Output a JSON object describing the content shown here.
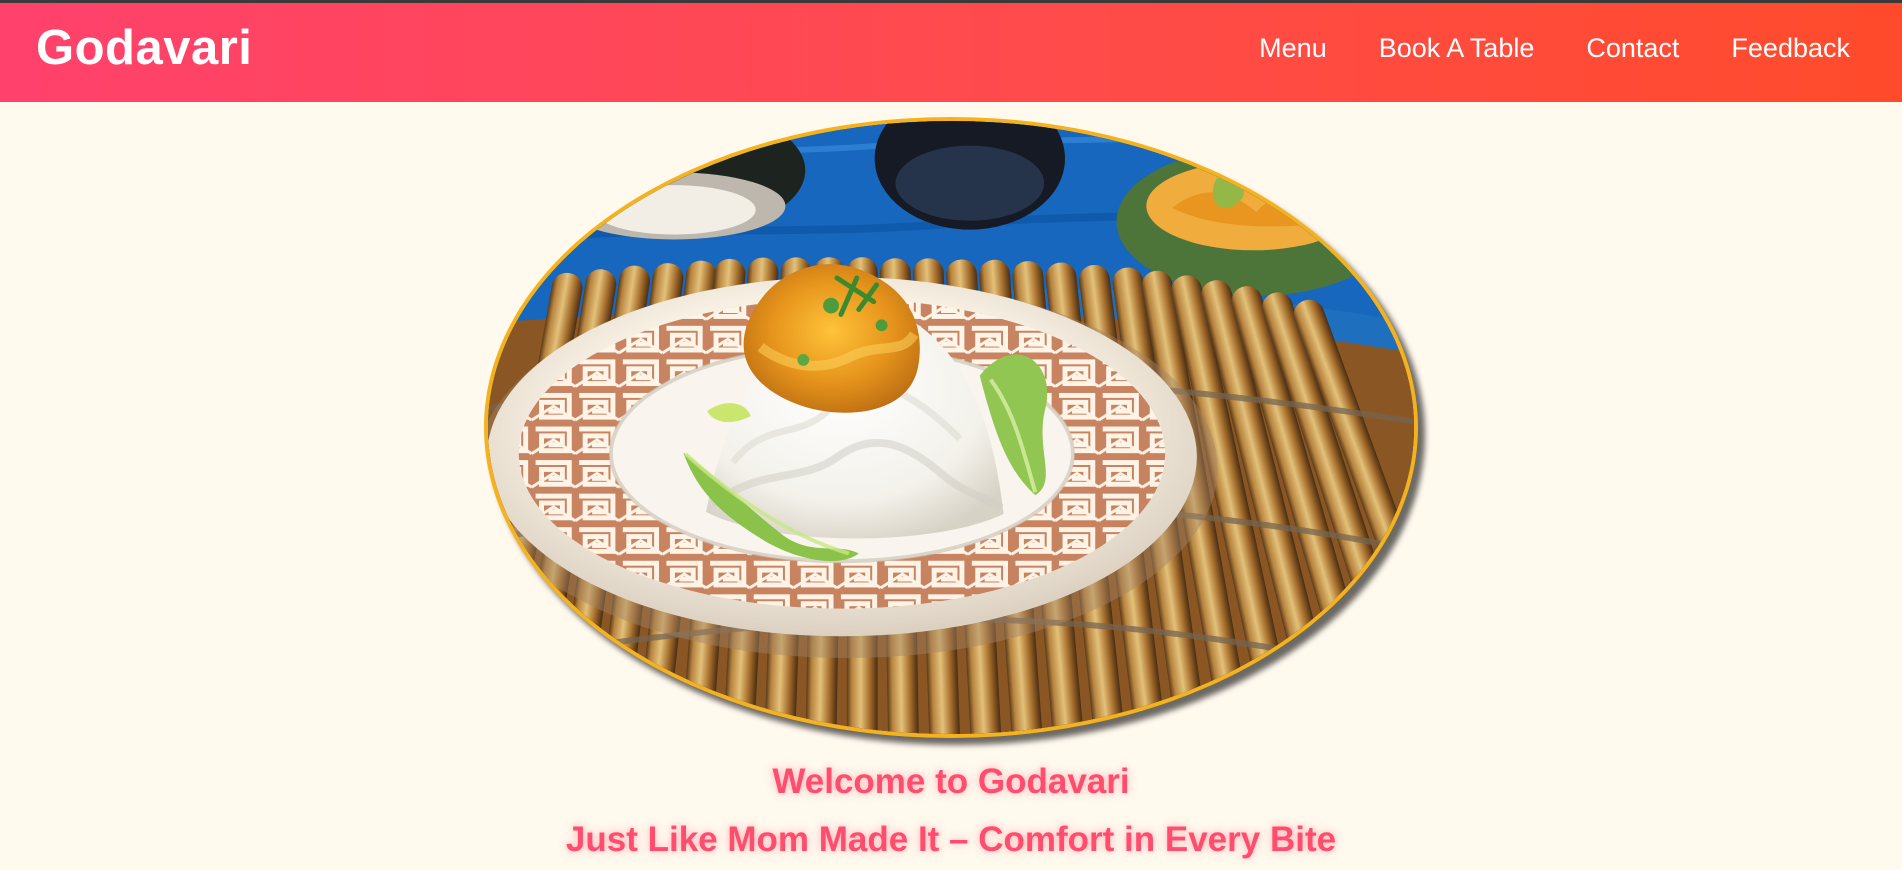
{
  "header": {
    "brand": "Godavari",
    "nav": [
      {
        "label": "Menu"
      },
      {
        "label": "Book A Table"
      },
      {
        "label": "Contact"
      },
      {
        "label": "Feedback"
      }
    ]
  },
  "hero": {
    "image_subject": "rice-with-curry-on-patterned-plate"
  },
  "welcome": {
    "title": "Welcome to Godavari",
    "tagline": "Just Like Mom Made It – Comfort in Every Bite"
  },
  "colors": {
    "header_gradient_start": "#ff416c",
    "header_gradient_end": "#ff4b2b",
    "page_background": "#fff9ee",
    "accent_text": "#ff4d6d",
    "hero_border": "#f6b21c"
  }
}
